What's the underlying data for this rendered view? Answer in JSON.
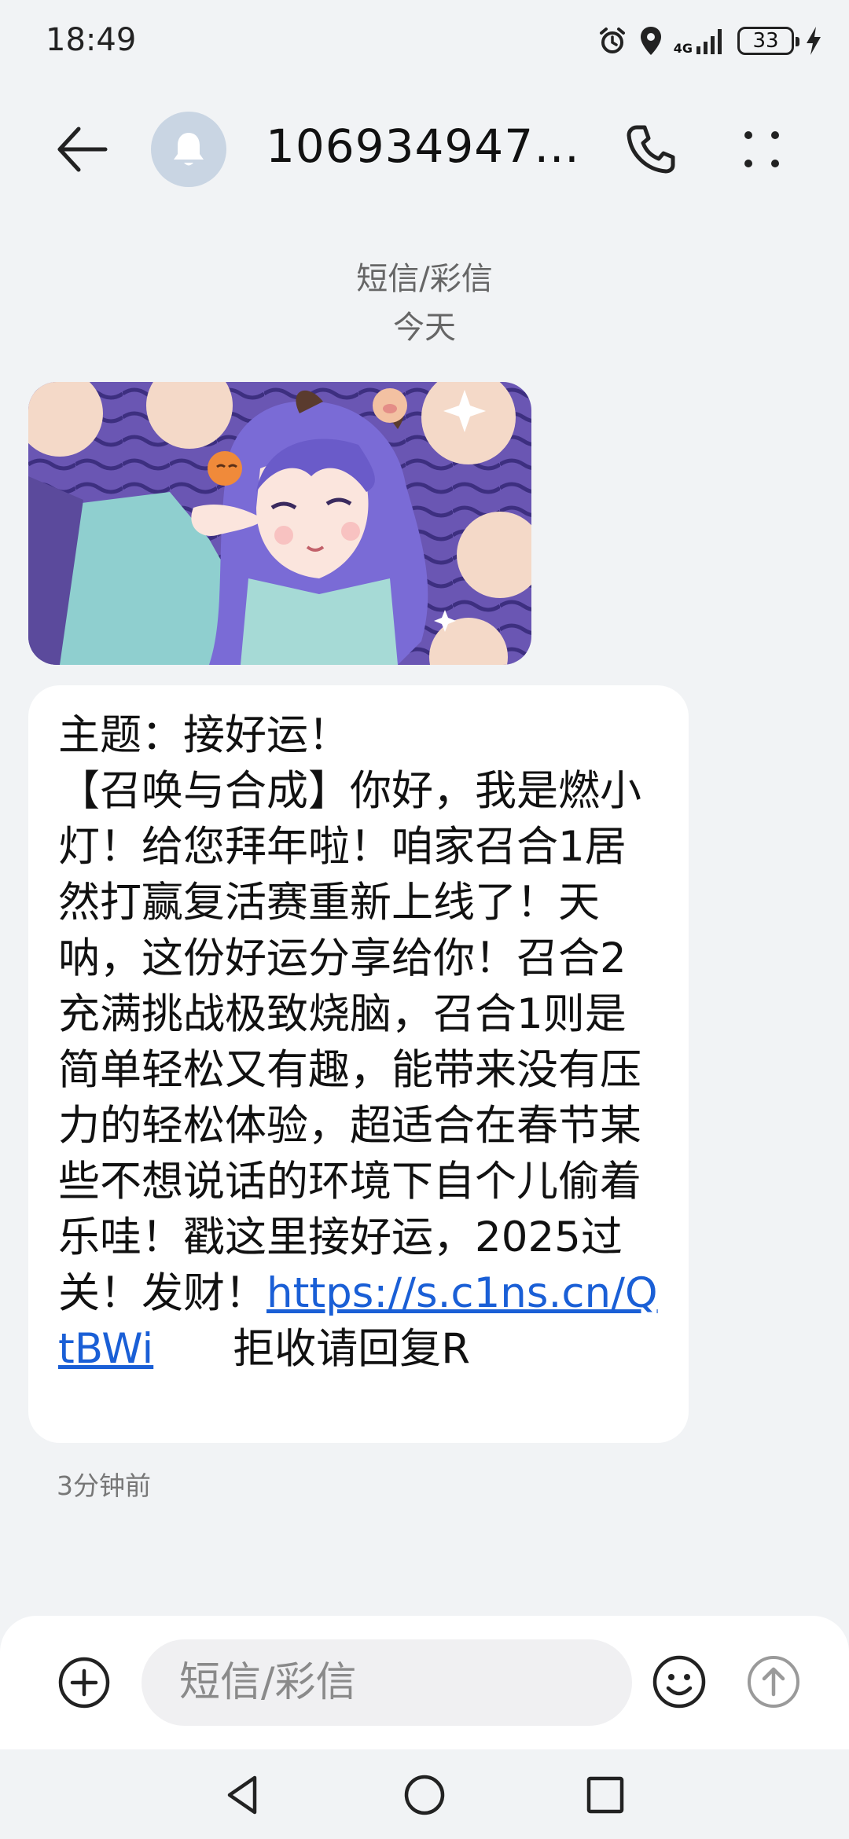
{
  "status_bar": {
    "time": "18:49",
    "network": "4G",
    "battery": "33"
  },
  "header": {
    "contact": "1069349479..."
  },
  "conversation": {
    "channel": "短信/彩信",
    "date": "今天"
  },
  "message": {
    "subject_line": "主题：接好运！",
    "body": "【召唤与合成】你好，我是燃小灯！给您拜年啦！咱家召合1居然打赢复活赛重新上线了！天呐，这份好运分享给你！召合2充满挑战极致烧脑，召合1则是简单轻松又有趣，能带来没有压力的轻松体验，超适合在春节某些不想说话的环境下自个儿偷着乐哇！戳这里接好运，2025过关！发财！",
    "link": "https://s.c1ns.cn/QtBWi",
    "tail": "拒收请回复R",
    "time_ago": "3分钟前"
  },
  "composer": {
    "placeholder": "短信/彩信"
  },
  "colors": {
    "link": "#1a5fd6",
    "background": "#f1f3f5",
    "avatar": "#c9d5e3"
  },
  "icons": [
    "alarm-icon",
    "location-icon",
    "signal-icon",
    "battery-icon",
    "charging-icon",
    "back-arrow-icon",
    "bell-icon",
    "phone-icon",
    "more-dots-icon",
    "add-icon",
    "emoji-icon",
    "send-icon",
    "nav-back-icon",
    "nav-home-icon",
    "nav-recents-icon"
  ]
}
